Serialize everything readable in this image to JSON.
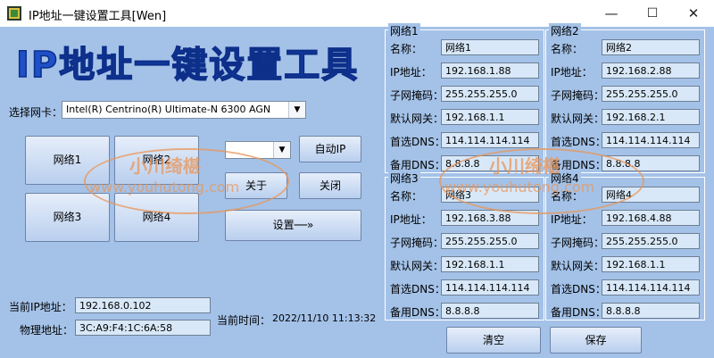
{
  "window": {
    "title": "IP地址一键设置工具[Wen]",
    "controls": {
      "minimize": "—",
      "maximize": "☐",
      "close": "✕"
    }
  },
  "app_title": "IP地址一键设置工具",
  "adapter": {
    "label": "选择网卡：",
    "value": "Intel(R) Centrino(R) Ultimate-N 6300 AGN"
  },
  "network_buttons": [
    "网络1",
    "网络2",
    "网络3",
    "网络4"
  ],
  "actions": {
    "dropdown_value": "",
    "auto_ip": "自动IP",
    "about": "关于",
    "close": "关闭",
    "apply": "设置──»"
  },
  "status": {
    "ip_label": "当前IP地址：",
    "ip_value": "192.168.0.102",
    "mac_label": "物理地址：",
    "mac_value": "3C:A9:F4:1C:6A:58",
    "time_label": "当前时间：",
    "time_value": "2022/11/10 11:13:32"
  },
  "field_labels": {
    "name": "名称：",
    "ip": "IP地址：",
    "mask": "子网掩码：",
    "gateway": "默认网关：",
    "dns1": "首选DNS：",
    "dns2": "备用DNS："
  },
  "networks": [
    {
      "group": "网络1",
      "name": "网络1",
      "ip": "192.168.1.88",
      "mask": "255.255.255.0",
      "gateway": "192.168.1.1",
      "dns1": "114.114.114.114",
      "dns2": "8.8.8.8"
    },
    {
      "group": "网络2",
      "name": "网络2",
      "ip": "192.168.2.88",
      "mask": "255.255.255.0",
      "gateway": "192.168.2.1",
      "dns1": "114.114.114.114",
      "dns2": "8.8.8.8"
    },
    {
      "group": "网络3",
      "name": "网络3",
      "ip": "192.168.3.88",
      "mask": "255.255.255.0",
      "gateway": "192.168.1.1",
      "dns1": "114.114.114.114",
      "dns2": "8.8.8.8"
    },
    {
      "group": "网络4",
      "name": "网络4",
      "ip": "192.168.4.88",
      "mask": "255.255.255.0",
      "gateway": "192.168.1.1",
      "dns1": "114.114.114.114",
      "dns2": "8.8.8.8"
    }
  ],
  "bottom_buttons": {
    "clear": "清空",
    "save": "保存"
  },
  "watermark": {
    "cn": "小川绮椹",
    "url": "www.youhutong.com"
  }
}
